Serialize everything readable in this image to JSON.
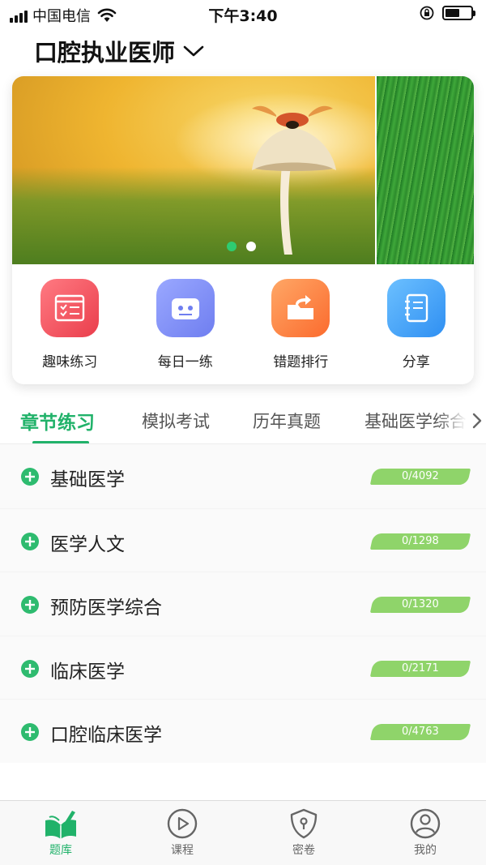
{
  "status_bar": {
    "carrier": "中国电信",
    "time": "下午3:40"
  },
  "header": {
    "title": "口腔执业医师"
  },
  "banner": {
    "slide_count": 2,
    "active_index": 0
  },
  "features": [
    {
      "label": "趣味练习",
      "icon": "exercise-icon",
      "color": "#f0545e"
    },
    {
      "label": "每日一练",
      "icon": "robot-icon",
      "color": "#7b8ff6"
    },
    {
      "label": "错题排行",
      "icon": "folder-upload-icon",
      "color": "#ff8a3c"
    },
    {
      "label": "分享",
      "icon": "notebook-icon",
      "color": "#3fa2f7"
    }
  ],
  "tabs": [
    {
      "label": "章节练习",
      "active": true
    },
    {
      "label": "模拟考试",
      "active": false
    },
    {
      "label": "历年真题",
      "active": false
    },
    {
      "label": "基础医学综合",
      "active": false
    }
  ],
  "chapters": [
    {
      "name": "基础医学",
      "progress": "0/4092"
    },
    {
      "name": "医学人文",
      "progress": "0/1298"
    },
    {
      "name": "预防医学综合",
      "progress": "0/1320"
    },
    {
      "name": "临床医学",
      "progress": "0/2171"
    },
    {
      "name": "口腔临床医学",
      "progress": "0/4763"
    }
  ],
  "bottom_nav": [
    {
      "label": "题库",
      "icon": "book-icon",
      "active": true
    },
    {
      "label": "课程",
      "icon": "play-circle-icon",
      "active": false
    },
    {
      "label": "密卷",
      "icon": "shield-lock-icon",
      "active": false
    },
    {
      "label": "我的",
      "icon": "user-icon",
      "active": false
    }
  ],
  "colors": {
    "accent": "#21b26a",
    "badge": "#8fd46a"
  }
}
